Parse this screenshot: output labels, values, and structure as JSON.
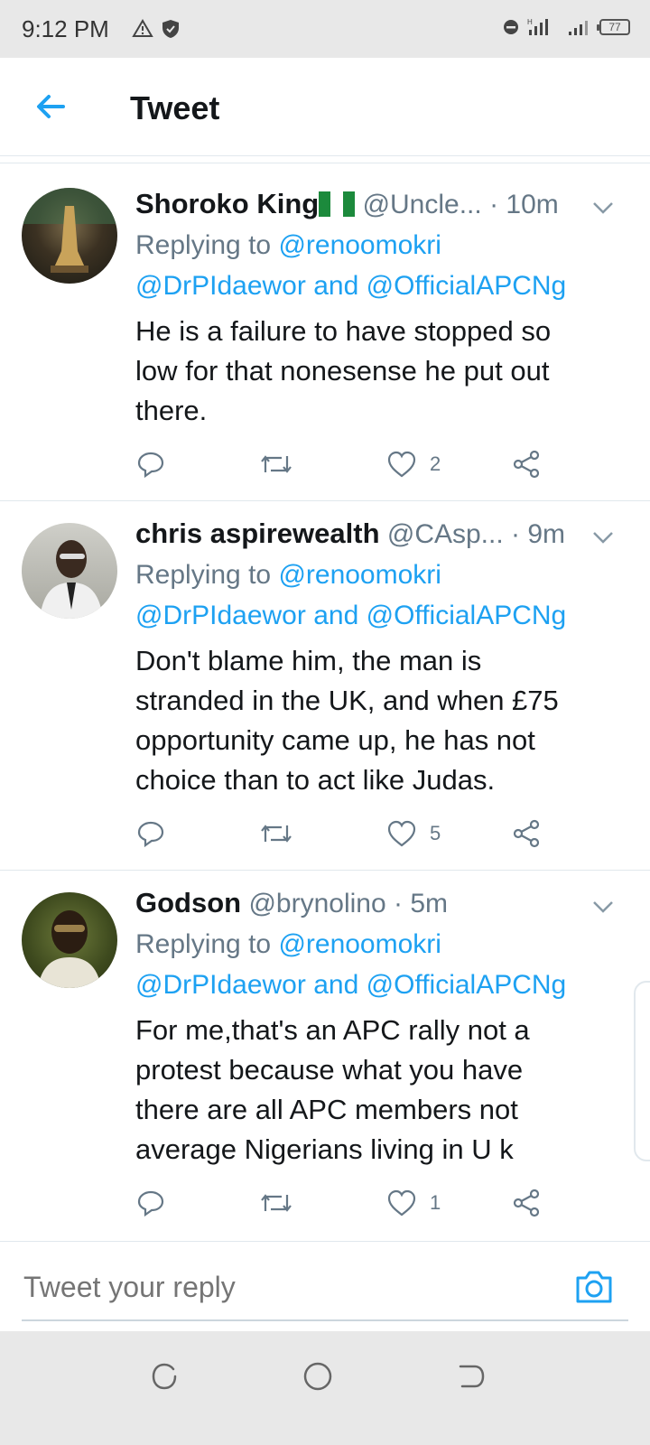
{
  "status_bar": {
    "time": "9:12 PM",
    "battery": "77"
  },
  "header": {
    "title": "Tweet"
  },
  "tweets": [
    {
      "display_name": "Shoroko King",
      "handle": "@Uncle...",
      "time": "10m",
      "replying_prefix": "Replying to",
      "mention1": "@renoomokri",
      "mention2": "@DrPIdaewor",
      "and_word": "and",
      "mention3": "@OfficialAPCNg",
      "body": [
        "He is a failure to have stopped so",
        "low for that nonesense he put out",
        "there."
      ],
      "likes": "2"
    },
    {
      "display_name": "chris aspirewealth",
      "handle": "@CAsp...",
      "time": "9m",
      "replying_prefix": "Replying to",
      "mention1": "@renoomokri",
      "mention2": "@DrPIdaewor",
      "and_word": "and",
      "mention3": "@OfficialAPCNg",
      "body": [
        "Don't blame him, the man is",
        "stranded in the UK, and when £75",
        "opportunity came up, he has not",
        "choice than to act like Judas."
      ],
      "likes": "5"
    },
    {
      "display_name": "Godson",
      "handle": "@brynolino",
      "time": "5m",
      "replying_prefix": "Replying to",
      "mention1": "@renoomokri",
      "mention2": "@DrPIdaewor",
      "and_word": "and",
      "mention3": "@OfficialAPCNg",
      "body": [
        "For me,that's an APC rally not a",
        "protest because what you have",
        "there are all APC members  not",
        "average Nigerians living in U k"
      ],
      "likes": "1"
    }
  ],
  "reply": {
    "placeholder": "Tweet your reply"
  },
  "icons": {
    "back": "arrow-left-icon",
    "chevron": "chevron-down-icon",
    "reply": "reply-icon",
    "retweet": "retweet-icon",
    "like": "heart-icon",
    "share": "share-icon",
    "camera": "camera-icon"
  },
  "colors": {
    "accent": "#1da1f2",
    "secondary_text": "#657786",
    "primary_text": "#14171a"
  }
}
